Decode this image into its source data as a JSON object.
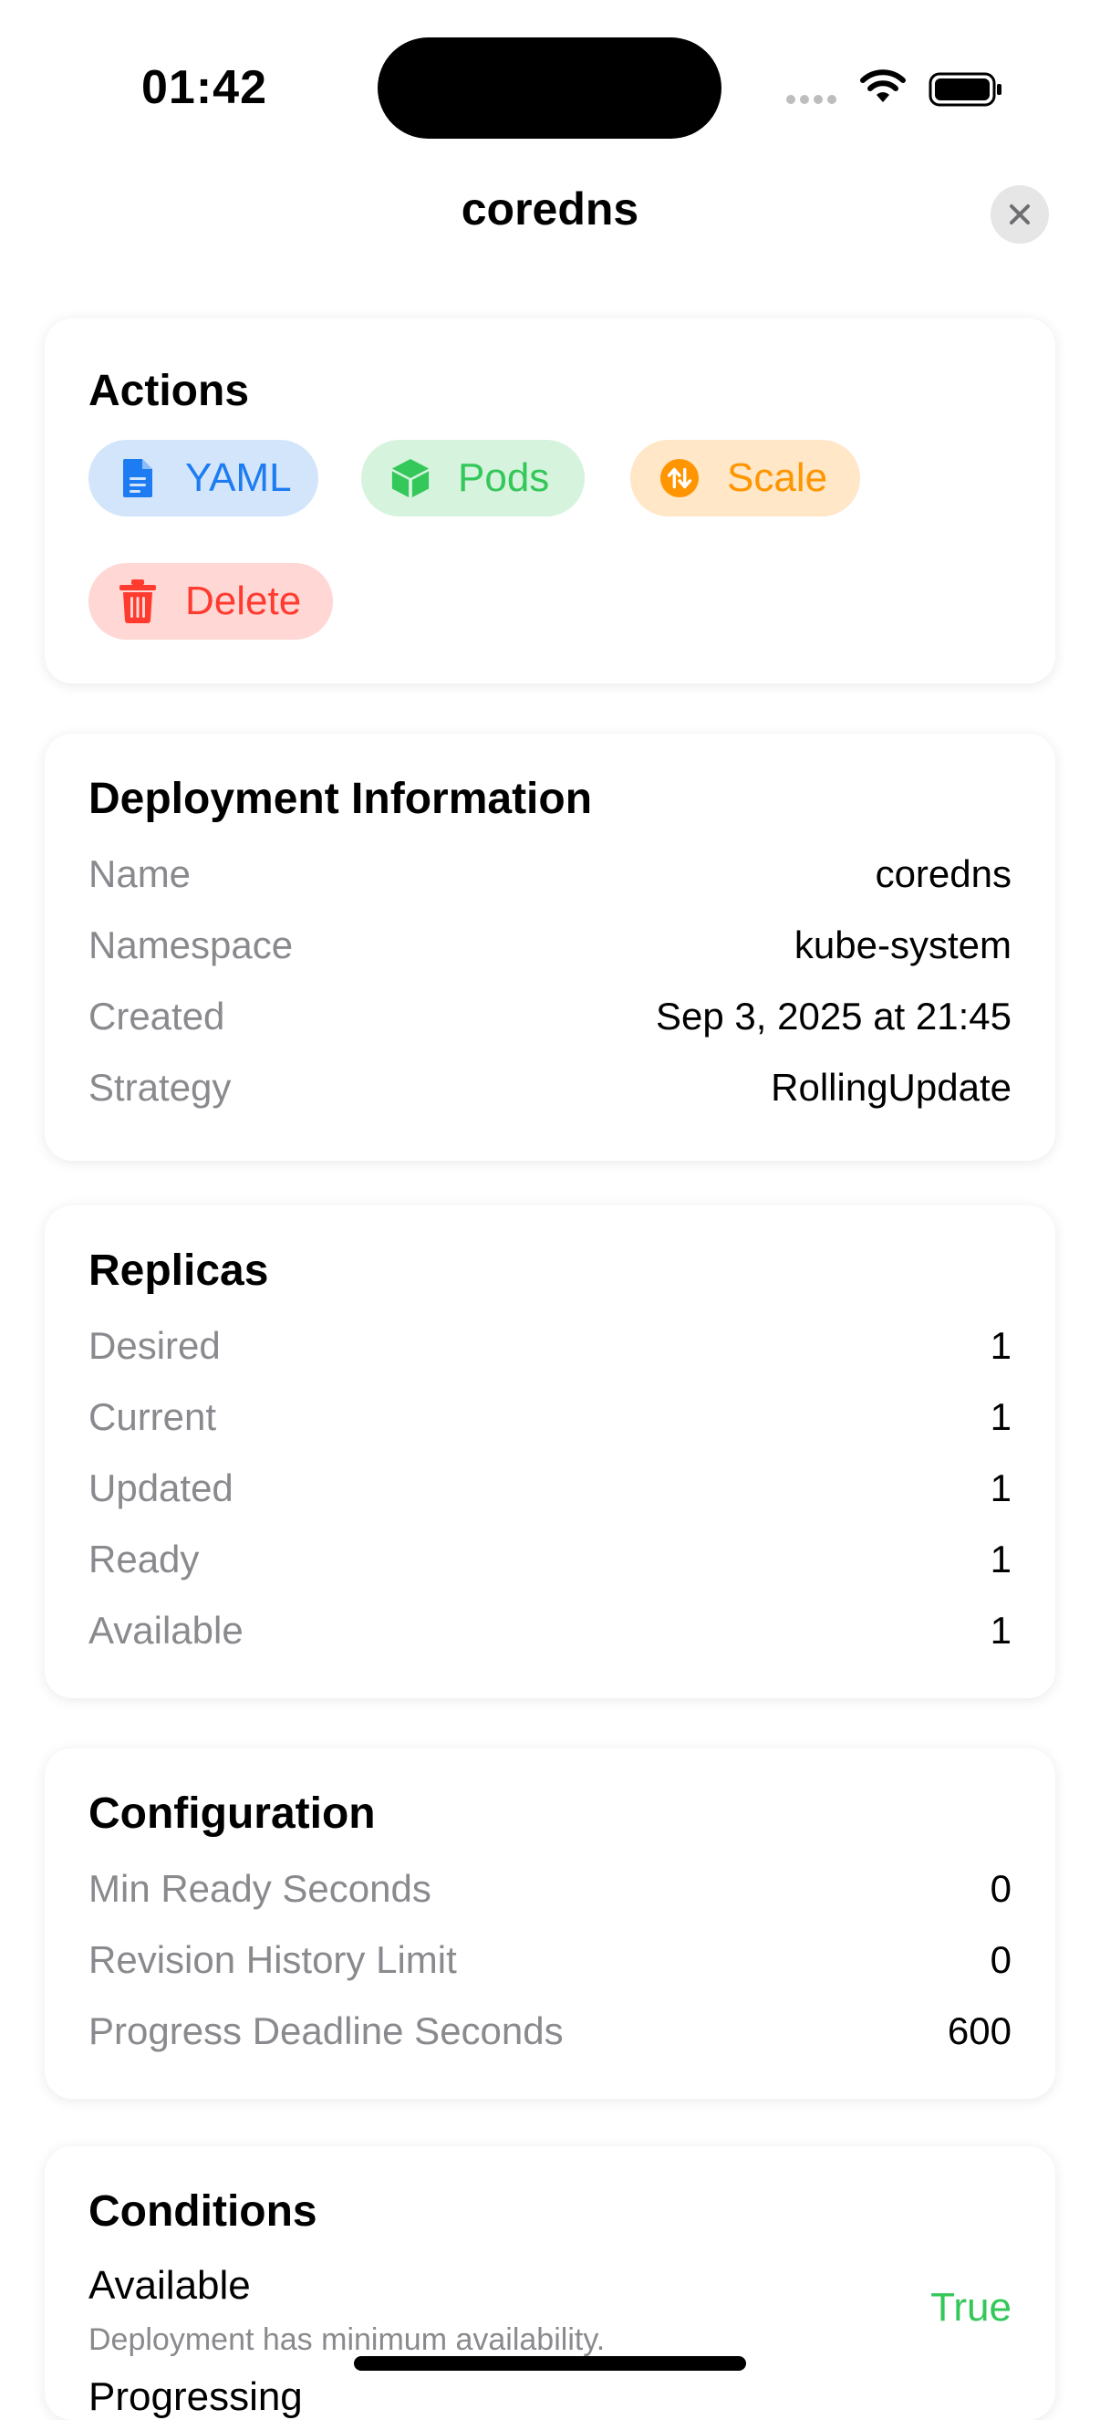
{
  "status_bar": {
    "time": "01:42"
  },
  "nav": {
    "title": "coredns",
    "close_icon": "xmark-icon"
  },
  "actions": {
    "title": "Actions",
    "buttons": [
      {
        "label": "YAML",
        "icon": "document-icon",
        "color": "#1e7cf2",
        "bg": "#d3e5fb"
      },
      {
        "label": "Pods",
        "icon": "cube-icon",
        "color": "#34c759",
        "bg": "#d6f3dd"
      },
      {
        "label": "Scale",
        "icon": "arrow-up-down-circle-icon",
        "color": "#ff9500",
        "bg": "#ffe7c7"
      },
      {
        "label": "Delete",
        "icon": "trash-icon",
        "color": "#ff3b30",
        "bg": "#ffd7d5"
      }
    ]
  },
  "deployment_info": {
    "title": "Deployment Information",
    "rows": [
      {
        "label": "Name",
        "value": "coredns"
      },
      {
        "label": "Namespace",
        "value": "kube-system"
      },
      {
        "label": "Created",
        "value": "Sep 3, 2025 at 21:45"
      },
      {
        "label": "Strategy",
        "value": "RollingUpdate"
      }
    ]
  },
  "replicas": {
    "title": "Replicas",
    "rows": [
      {
        "label": "Desired",
        "value": "1"
      },
      {
        "label": "Current",
        "value": "1"
      },
      {
        "label": "Updated",
        "value": "1"
      },
      {
        "label": "Ready",
        "value": "1"
      },
      {
        "label": "Available",
        "value": "1"
      }
    ]
  },
  "configuration": {
    "title": "Configuration",
    "rows": [
      {
        "label": "Min Ready Seconds",
        "value": "0"
      },
      {
        "label": "Revision History Limit",
        "value": "0"
      },
      {
        "label": "Progress Deadline Seconds",
        "value": "600"
      }
    ]
  },
  "conditions": {
    "title": "Conditions",
    "items": [
      {
        "type": "Available",
        "message": "Deployment has minimum availability.",
        "status": "True"
      },
      {
        "type": "Progressing"
      }
    ]
  }
}
